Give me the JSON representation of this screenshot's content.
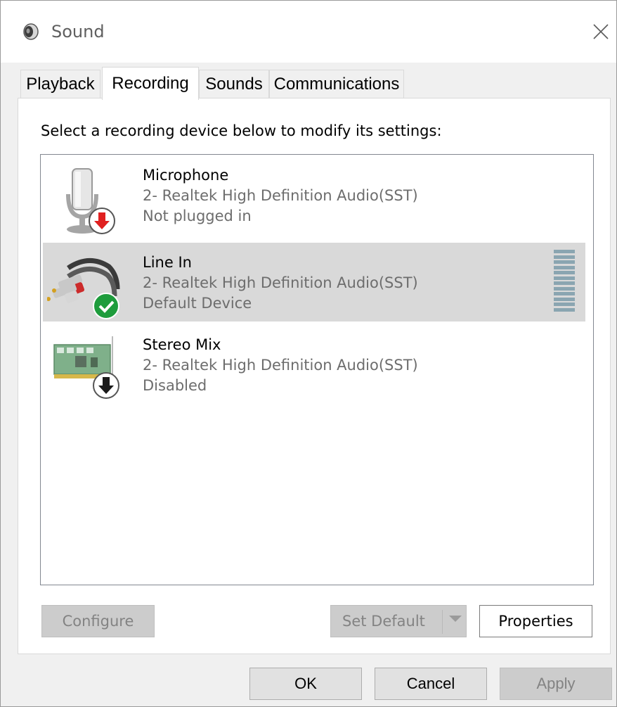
{
  "window": {
    "title": "Sound"
  },
  "tabs": [
    {
      "label": "Playback"
    },
    {
      "label": "Recording"
    },
    {
      "label": "Sounds"
    },
    {
      "label": "Communications"
    }
  ],
  "active_tab": "Recording",
  "instruction": "Select a recording device below to modify its settings:",
  "devices": [
    {
      "name": "Microphone",
      "driver": "2- Realtek High Definition Audio(SST)",
      "status": "Not plugged in",
      "icon": "microphone-icon",
      "badge": "red-down-arrow-icon"
    },
    {
      "name": "Line In",
      "driver": "2- Realtek High Definition Audio(SST)",
      "status": "Default Device",
      "icon": "rca-cable-icon",
      "badge": "green-check-icon",
      "selected": true
    },
    {
      "name": "Stereo Mix",
      "driver": "2- Realtek High Definition Audio(SST)",
      "status": "Disabled",
      "icon": "sound-card-icon",
      "badge": "black-down-arrow-icon"
    }
  ],
  "buttons": {
    "configure": "Configure",
    "set_default": "Set Default",
    "properties": "Properties",
    "ok": "OK",
    "cancel": "Cancel",
    "apply": "Apply"
  },
  "colors": {
    "selection": "#d9d9d9",
    "check_badge": "#1e9c3c",
    "red_badge": "#e02020",
    "level_meter": "#8aa5b1"
  }
}
